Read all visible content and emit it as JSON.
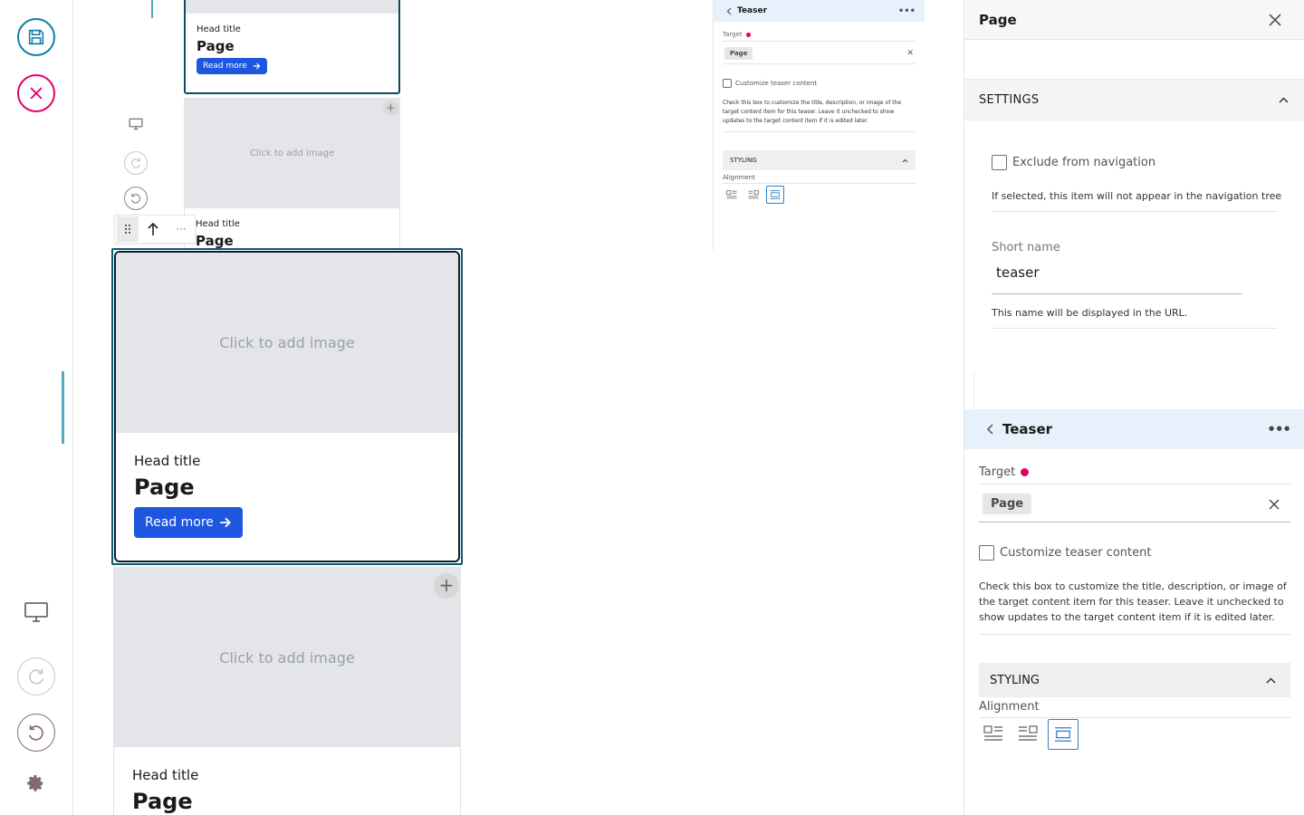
{
  "toolbar": {
    "save_icon": "save-icon",
    "cancel_icon": "cancel-icon",
    "colors": {
      "save": "#0f7fa8",
      "cancel": "#e40166"
    }
  },
  "canvas": {
    "cards": [
      {
        "head": "Head title",
        "title": "Page",
        "read_more": "Read more"
      },
      {
        "image_placeholder": "Click to add image",
        "head": "Head title",
        "title": "Page"
      },
      {
        "image_placeholder": "Click to add image",
        "head": "Head title",
        "title": "Page",
        "read_more": "Read more"
      },
      {
        "image_placeholder": "Click to add image",
        "head": "Head title",
        "title": "Page"
      }
    ]
  },
  "mini_teaser": {
    "title": "Teaser",
    "target_label": "Target",
    "target_chip": "Page",
    "customize_label": "Customize teaser content",
    "help": "Check this box to customize the title, description, or image of the target content item for this teaser. Leave it unchecked to show updates to the target content item if it is edited later.",
    "styling": "STYLING",
    "alignment": "Alignment"
  },
  "sidebar": {
    "title": "Page",
    "settings": "SETTINGS",
    "exclude_label": "Exclude from navigation",
    "exclude_help": "If selected, this item will not appear in the navigation tree",
    "short_name_label": "Short name",
    "short_name_value": "teaser",
    "short_name_help": "This name will be displayed in the URL.",
    "teaser": {
      "title": "Teaser",
      "target_label": "Target",
      "target_chip": "Page",
      "customize_label": "Customize teaser content",
      "help": "Check this box to customize the title, description, or image of the target content item for this teaser. Leave it unchecked to show updates to the target content item if it is edited later.",
      "styling": "STYLING",
      "alignment": "Alignment"
    }
  }
}
